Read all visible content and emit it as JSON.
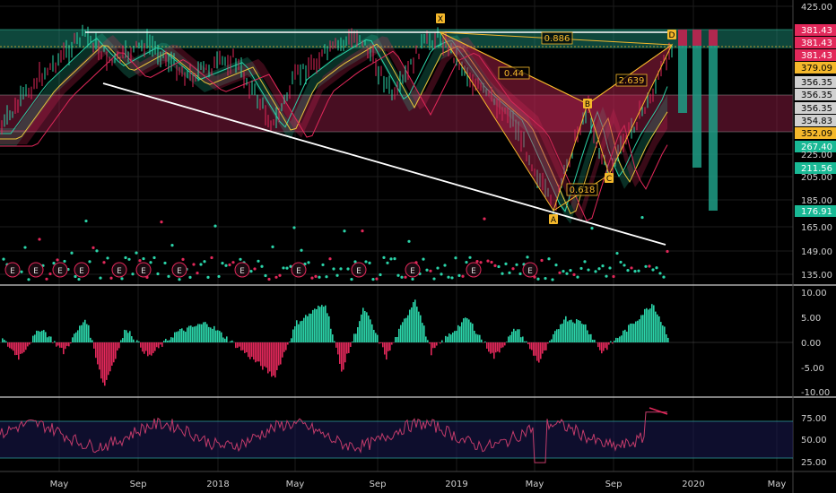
{
  "colors": {
    "bg": "#000000",
    "grid": "#1c1c1c",
    "bull": "#2bd4a9",
    "bear": "#e2285a",
    "price_tag_yellow": "#f5b82b",
    "price_tag_gray": "#d0d0d0",
    "price_tag_teal": "#19b995",
    "pattern_line": "#f5b82b",
    "trend_line": "#ffffff",
    "rsi_line": "#c23b6a",
    "rsi_band_line": "#2fa1a0"
  },
  "chart_data": [
    {
      "type": "line",
      "panel": "price",
      "scale": "log",
      "x_axis": {
        "labels": [
          "May",
          "Sep",
          "2018",
          "May",
          "Sep",
          "2019",
          "May",
          "Sep",
          "2020",
          "May"
        ]
      },
      "y_ticks": [
        425.0,
        381.43,
        379.09,
        356.35,
        354.83,
        352.09,
        267.4,
        225.0,
        211.56,
        205.0,
        185.0,
        176.91,
        165.0,
        149.0,
        135.0
      ],
      "price_tags": [
        {
          "label": "381.43",
          "style": "bear"
        },
        {
          "label": "381.43",
          "style": "bear"
        },
        {
          "label": "381.43",
          "style": "bear"
        },
        {
          "label": "379.09",
          "style": "yellow"
        },
        {
          "label": "356.35",
          "style": "gray"
        },
        {
          "label": "356.35",
          "style": "gray"
        },
        {
          "label": "356.35",
          "style": "gray"
        },
        {
          "label": "354.83",
          "style": "gray"
        },
        {
          "label": "352.09",
          "style": "yellow"
        },
        {
          "label": "267.40",
          "style": "teal"
        },
        {
          "label": "211.56",
          "style": "teal"
        },
        {
          "label": "176.91",
          "style": "teal"
        }
      ],
      "axis_ticks": [
        "425.00",
        "225.00",
        "205.00",
        "185.00",
        "165.00",
        "149.00",
        "135.00"
      ],
      "harmonic_pattern": {
        "points": [
          "X",
          "A",
          "B",
          "C",
          "D"
        ],
        "ratios": [
          "0.886",
          "0.44",
          "2.639",
          "0.618"
        ]
      },
      "earnings_markers": [
        "E",
        "E",
        "E",
        "E",
        "E",
        "E",
        "E",
        "E",
        "E",
        "E",
        "E",
        "E",
        "E"
      ]
    },
    {
      "type": "bar",
      "panel": "oscillator",
      "y_ticks": [
        "10.00",
        "5.00",
        "0.00",
        "-5.00",
        "-10.00"
      ],
      "range": [
        -10,
        10
      ]
    },
    {
      "type": "line",
      "panel": "rsi",
      "y_ticks": [
        "75.00",
        "50.00",
        "25.00"
      ],
      "bands": [
        70,
        30
      ]
    }
  ]
}
